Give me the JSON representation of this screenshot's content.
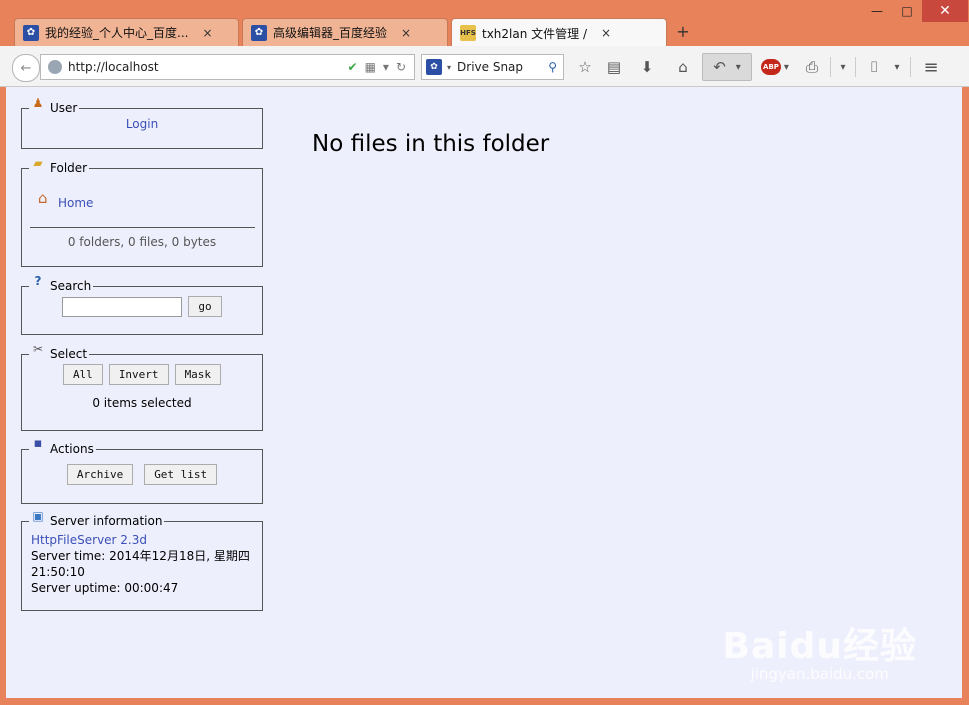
{
  "window_controls": {
    "minimize": "—",
    "maximize": "□",
    "close": "✕"
  },
  "tabs": [
    {
      "title": "我的经验_个人中心_百度...",
      "icon": "paw-icon",
      "close": "×"
    },
    {
      "title": "高级编辑器_百度经验",
      "icon": "paw-icon",
      "close": "×"
    },
    {
      "title": "txh2lan 文件管理 /",
      "icon": "hfs-icon",
      "close": "×"
    }
  ],
  "hfs_icon_text": "HFS",
  "new_tab": "+",
  "nav": {
    "back": "←",
    "url": "http://localhost",
    "search_engine": "Drive Snap",
    "icons": [
      "back-icon",
      "globe-icon",
      "shield-icon",
      "qr-icon",
      "dropdown-icon",
      "reload-icon",
      "star-icon",
      "reading-list-icon",
      "download-icon",
      "home-icon",
      "undo-icon",
      "adblock-icon",
      "print-icon",
      "screenshot-icon",
      "menu-icon"
    ]
  },
  "toolbar_glyphs": {
    "star": "☆",
    "reading": "▤",
    "download": "⬇",
    "home": "⌂",
    "undo": "↶",
    "dropdown": "▾",
    "adblock": "ABP",
    "print": "⎙",
    "camera": "⌷",
    "menu": "≡",
    "qr": "▦",
    "reload": "↻",
    "magnifier": "⚲",
    "shield": "✔"
  },
  "panels": {
    "user": {
      "legend": "User",
      "login": "Login"
    },
    "folder": {
      "legend": "Folder",
      "home": "Home",
      "stats": "0 folders, 0 files, 0 bytes"
    },
    "search": {
      "legend": "Search",
      "value": "",
      "go": "go"
    },
    "select": {
      "legend": "Select",
      "all": "All",
      "invert": "Invert",
      "mask": "Mask",
      "status": "0 items selected"
    },
    "actions": {
      "legend": "Actions",
      "archive": "Archive",
      "get_list": "Get list"
    },
    "server": {
      "legend": "Server information",
      "version": "HttpFileServer 2.3d",
      "time": "Server time: 2014年12月18日, 星期四 21:50:10",
      "uptime": "Server uptime: 00:00:47"
    }
  },
  "main": {
    "message": "No files in this folder"
  },
  "watermark": {
    "main": "Baidu经验",
    "sub": "jingyan.baidu.com"
  },
  "colors": {
    "titlebar": "#e8825a",
    "content_bg": "#eeeffc",
    "link": "#3a50b8",
    "close_red": "#c9483e"
  }
}
